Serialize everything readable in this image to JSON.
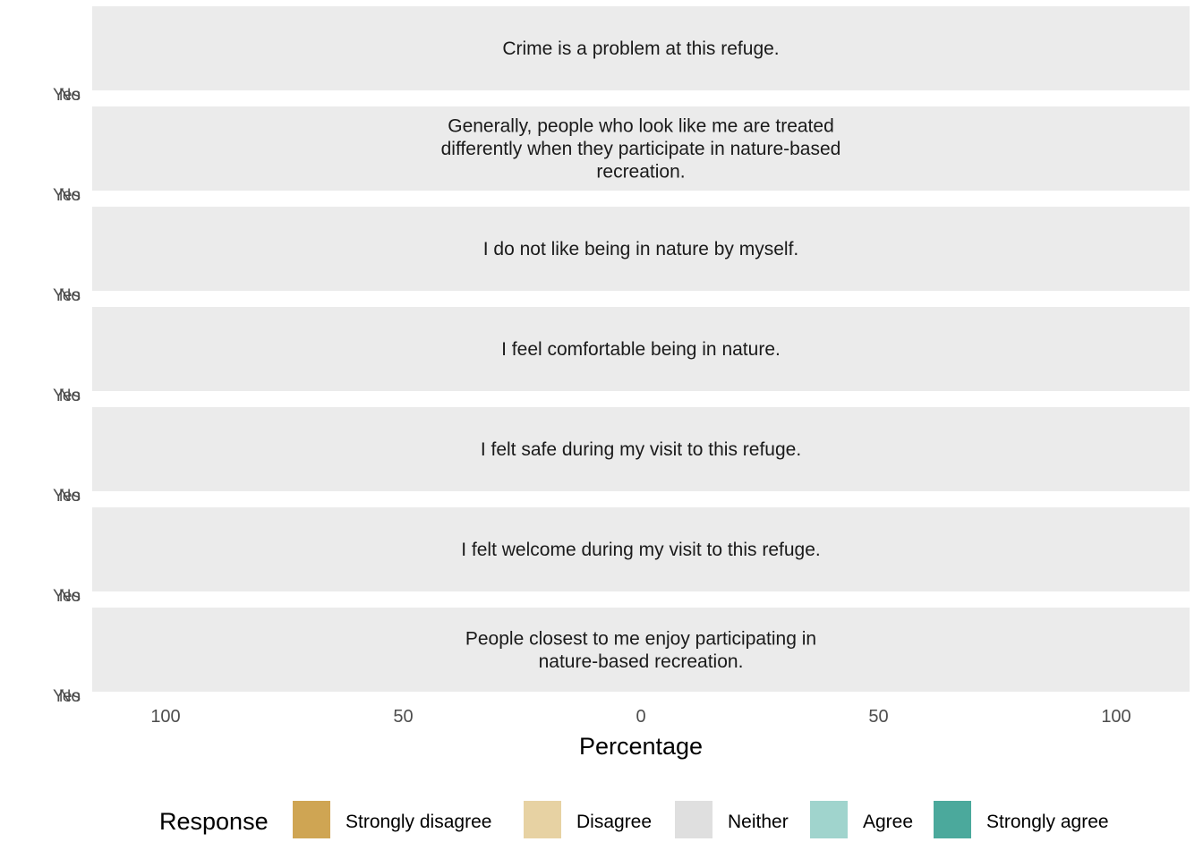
{
  "chart_data": {
    "type": "bar",
    "orientation": "horizontal",
    "style": "diverging stacked",
    "xlabel": "Percentage",
    "xlim": [
      -100,
      100
    ],
    "x_ticks": [
      {
        "value": -100,
        "label": "100"
      },
      {
        "value": -50,
        "label": "50"
      },
      {
        "value": 0,
        "label": "0"
      },
      {
        "value": 50,
        "label": "50"
      },
      {
        "value": 100,
        "label": "100"
      }
    ],
    "grid": false,
    "legend": {
      "title": "Response",
      "position": "bottom",
      "entries": [
        "Strongly disagree",
        "Disagree",
        "Neither",
        "Agree",
        "Strongly agree"
      ]
    },
    "series": [
      {
        "name": "Strongly disagree",
        "color": "#CFA553"
      },
      {
        "name": "Disagree",
        "color": "#E7D2A3"
      },
      {
        "name": "Neither",
        "color": "#DFDFDF"
      },
      {
        "name": "Agree",
        "color": "#A0D4CD"
      },
      {
        "name": "Strongly agree",
        "color": "#4BA99C"
      }
    ],
    "panels": [
      {
        "title": [
          "Crime is a problem at this refuge."
        ],
        "categories": [
          "Yes",
          "No"
        ]
      },
      {
        "title": [
          "Generally, people who look like me are treated",
          "differently when they participate in nature-based",
          "recreation."
        ],
        "categories": [
          "Yes",
          "No"
        ]
      },
      {
        "title": [
          "I do not like being in nature by myself."
        ],
        "categories": [
          "Yes",
          "No"
        ]
      },
      {
        "title": [
          "I feel comfortable being in nature."
        ],
        "categories": [
          "Yes",
          "No"
        ]
      },
      {
        "title": [
          "I felt safe during my visit to this refuge."
        ],
        "categories": [
          "Yes",
          "No"
        ]
      },
      {
        "title": [
          "I felt welcome during my visit to this refuge."
        ],
        "categories": [
          "Yes",
          "No"
        ]
      },
      {
        "title": [
          "People closest to me enjoy participating in",
          "nature-based recreation."
        ],
        "categories": [
          "Yes",
          "No"
        ]
      }
    ]
  }
}
